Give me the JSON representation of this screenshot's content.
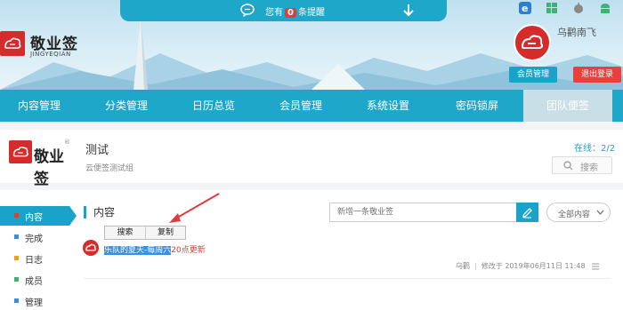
{
  "notice": {
    "prefix": "您有",
    "count": "0",
    "suffix": "条提醒"
  },
  "brand": {
    "name": "敬业签",
    "sub": "JINGYEQIAN"
  },
  "platforms": [
    "ie-icon",
    "windows-icon",
    "apple-icon",
    "android-icon"
  ],
  "user": {
    "name": "乌鹳南飞",
    "member_button": "会员管理",
    "logout_button": "退出登录"
  },
  "nav": {
    "items": [
      {
        "label": "内容管理"
      },
      {
        "label": "分类管理"
      },
      {
        "label": "日历总览"
      },
      {
        "label": "会员管理"
      },
      {
        "label": "系统设置"
      },
      {
        "label": "密码锁屏"
      },
      {
        "label": "团队便签"
      }
    ],
    "active_index": 6
  },
  "team": {
    "logo_text": "敬业签",
    "title": "测试",
    "description": "云便签测试组",
    "online": "在线：2/2",
    "search_label": "搜索"
  },
  "sidebar": {
    "items": [
      {
        "label": "内容",
        "color": "#e23b3b"
      },
      {
        "label": "完成",
        "color": "#3a8fe0"
      },
      {
        "label": "日志",
        "color": "#f0a020"
      },
      {
        "label": "成员",
        "color": "#3cb371"
      },
      {
        "label": "管理",
        "color": "#3a8fe0"
      }
    ],
    "active_index": 0
  },
  "main": {
    "title": "内容",
    "new_placeholder": "新增一条敬业签",
    "filter_label": "全部内容",
    "popup": {
      "search": "搜索",
      "copy": "复制"
    },
    "note": {
      "highlighted": "乐队的夏天-每周六",
      "rest": "20点更新",
      "author": "乌鹳",
      "modified": "修改于 2019年06月11日 11:48"
    }
  },
  "colors": {
    "primary": "#1fa7c9",
    "danger": "#e8413d",
    "brand_red": "#d52b2b"
  }
}
